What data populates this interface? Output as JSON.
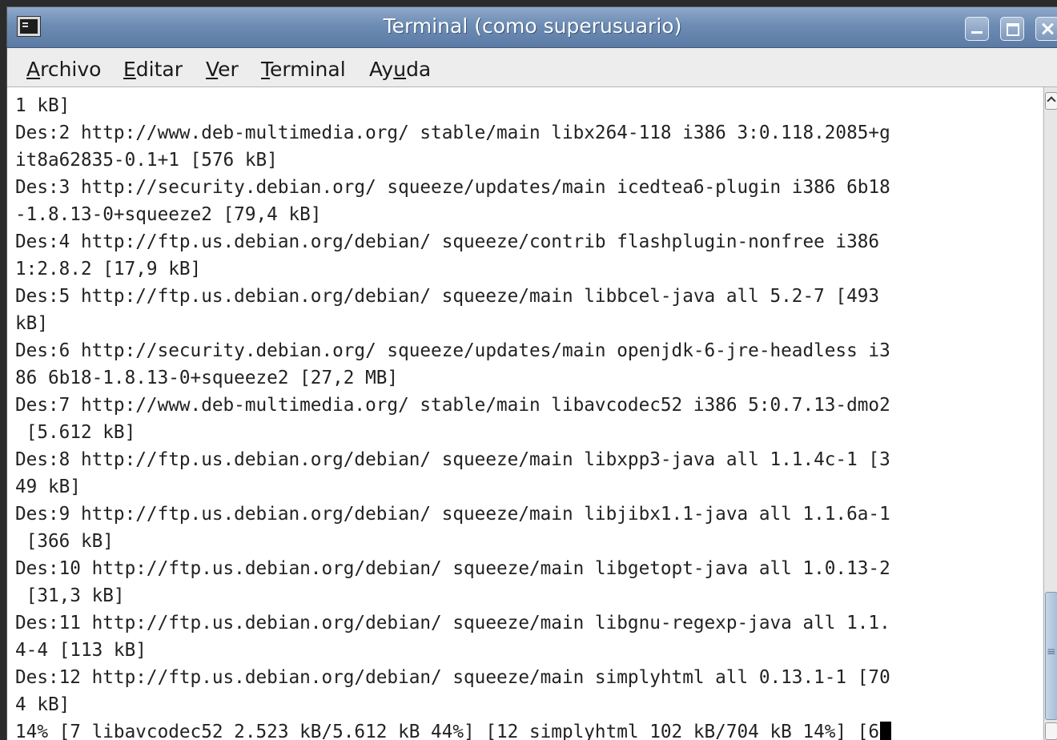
{
  "window": {
    "title": "Terminal (como superusuario)"
  },
  "menubar": {
    "archivo": {
      "pre": "",
      "key": "A",
      "post": "rchivo"
    },
    "editar": {
      "pre": "",
      "key": "E",
      "post": "ditar"
    },
    "ver": {
      "pre": "",
      "key": "V",
      "post": "er"
    },
    "terminal": {
      "pre": "",
      "key": "T",
      "post": "erminal"
    },
    "ayuda": {
      "pre": "Ay",
      "key": "u",
      "post": "da"
    }
  },
  "terminal": {
    "lines": [
      "1 kB]",
      "Des:2 http://www.deb-multimedia.org/ stable/main libx264-118 i386 3:0.118.2085+g",
      "it8a62835-0.1+1 [576 kB]",
      "Des:3 http://security.debian.org/ squeeze/updates/main icedtea6-plugin i386 6b18",
      "-1.8.13-0+squeeze2 [79,4 kB]",
      "Des:4 http://ftp.us.debian.org/debian/ squeeze/contrib flashplugin-nonfree i386",
      "1:2.8.2 [17,9 kB]",
      "Des:5 http://ftp.us.debian.org/debian/ squeeze/main libbcel-java all 5.2-7 [493",
      "kB]",
      "Des:6 http://security.debian.org/ squeeze/updates/main openjdk-6-jre-headless i3",
      "86 6b18-1.8.13-0+squeeze2 [27,2 MB]",
      "Des:7 http://www.deb-multimedia.org/ stable/main libavcodec52 i386 5:0.7.13-dmo2",
      " [5.612 kB]",
      "Des:8 http://ftp.us.debian.org/debian/ squeeze/main libxpp3-java all 1.1.4c-1 [3",
      "49 kB]",
      "Des:9 http://ftp.us.debian.org/debian/ squeeze/main libjibx1.1-java all 1.1.6a-1",
      " [366 kB]",
      "Des:10 http://ftp.us.debian.org/debian/ squeeze/main libgetopt-java all 1.0.13-2",
      " [31,3 kB]",
      "Des:11 http://ftp.us.debian.org/debian/ squeeze/main libgnu-regexp-java all 1.1.",
      "4-4 [113 kB]",
      "Des:12 http://ftp.us.debian.org/debian/ squeeze/main simplyhtml all 0.13.1-1 [70",
      "4 kB]"
    ],
    "status_line": "14% [7 libavcodec52 2.523 kB/5.612 kB 44%] [12 simplyhtml 102 kB/704 kB 14%] [6"
  }
}
